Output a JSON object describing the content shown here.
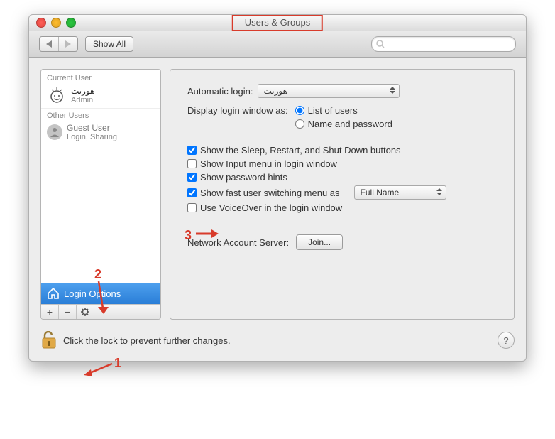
{
  "window": {
    "title": "Users & Groups"
  },
  "toolbar": {
    "show_all_label": "Show All",
    "search_placeholder": ""
  },
  "sidebar": {
    "current_label": "Current User",
    "current_user_name": "هورنت",
    "current_user_role": "Admin",
    "other_label": "Other Users",
    "guest_name": "Guest User",
    "guest_role": "Login, Sharing",
    "login_options_label": "Login Options"
  },
  "main": {
    "auto_login_label": "Automatic login:",
    "auto_login_value": "هورنت",
    "display_login_label": "Display login window as:",
    "radio_list": "List of users",
    "radio_namepw": "Name and password",
    "chk_sleep": "Show the Sleep, Restart, and Shut Down buttons",
    "chk_input": "Show Input menu in login window",
    "chk_hints": "Show password hints",
    "chk_fast": "Show fast user switching menu as",
    "fast_select_value": "Full Name",
    "chk_voiceover": "Use VoiceOver in the login window",
    "netacct_label": "Network Account Server:",
    "join_label": "Join..."
  },
  "footer": {
    "lock_text": "Click the lock to prevent further changes."
  },
  "annotations": {
    "a1": "1",
    "a2": "2",
    "a3": "3"
  }
}
